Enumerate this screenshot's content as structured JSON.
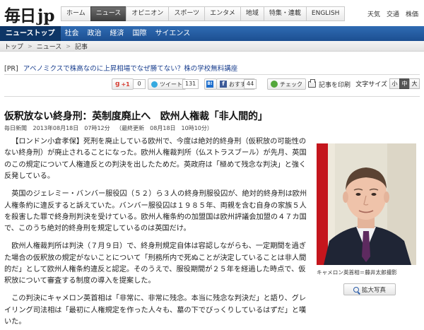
{
  "header": {
    "logo_kanji": "毎日",
    "logo_jp": "jp",
    "nav": [
      "ホーム",
      "ニュース",
      "オピニオン",
      "スポーツ",
      "エンタメ",
      "地域",
      "特集・連載",
      "ENGLISH"
    ],
    "active_nav": "ニュース",
    "utility_links": [
      "天気",
      "交通",
      "株価"
    ]
  },
  "subnav": {
    "items": [
      "ニューストップ",
      "社会",
      "政治",
      "経済",
      "国際",
      "サイエンス"
    ],
    "active": "ニューストップ"
  },
  "breadcrumb": [
    "トップ",
    "ニュース",
    "記事"
  ],
  "pr": {
    "tag": "[PR]",
    "link_text": "アベノミクスで株高なのに上昇相場でなぜ勝てない？株の学校無料講座"
  },
  "social": {
    "gplus_label": "+1",
    "gplus_count": "0",
    "tweet_label": "ツイート",
    "tweet_count": "131",
    "hatena_label": "B!",
    "fb_label": "おすすめ",
    "fb_count": "44",
    "check_label": "チェック",
    "print_label": "記事を印刷",
    "textsize_label": "文字サイズ",
    "textsize_options": [
      "小",
      "中",
      "大"
    ],
    "textsize_selected": "中"
  },
  "article": {
    "title": "仮釈放ない終身刑：英制度廃止へ　欧州人権裁「非人間的」",
    "source": "毎日新聞",
    "date": "2013年08月18日　07時12分",
    "updated": "（最終更新　08月18日　10時10分）",
    "paragraphs": [
      "【ロンドン小倉孝保】死刑を廃止している欧州で、今度は絶対的終身刑（仮釈放の可能性のない終身刑）が廃止されることになった。欧州人権裁判所（仏ストラスブール）が先月、英国のこの規定について人権違反との判決を出したためだ。英政府は「極めて残念な判決」と強く反発している。",
      "英国のジェレミー・バンバー服役囚（５２）ら３人の終身刑服役囚が、絶対的終身刑は欧州人権条約に違反すると訴えていた。バンバー服役囚は１９８５年、両親を含む自身の家族５人を殺害した罪で終身刑判決を受けている。欧州人権条約の加盟国は欧州評議会加盟の４７カ国で、このうち絶対的終身刑を規定しているのは英国だけ。",
      "欧州人権裁判所は判決（７月９日）で、終身刑規定自体は容認しながらも、一定期間を過ぎた場合の仮釈放の規定がないことについて「刑務所内で死ぬことが決定していることは非人間的だ」として欧州人権条約違反と認定。そのうえで、服役期間が２５年を経過した時点で、仮釈放について審査する制度の導入を提案した。",
      "この判決にキャメロン英首相は「非常に、非常に残念。本当に残念な判決だ」と語り、グレイリング司法相は「最初に人権規定を作った人々も、墓の下でびっくりしているはずだ」と嘆いた。"
    ],
    "photo_caption": "キャメロン英首相＝藤井太郎撮影",
    "enlarge_label": "拡大写真"
  }
}
